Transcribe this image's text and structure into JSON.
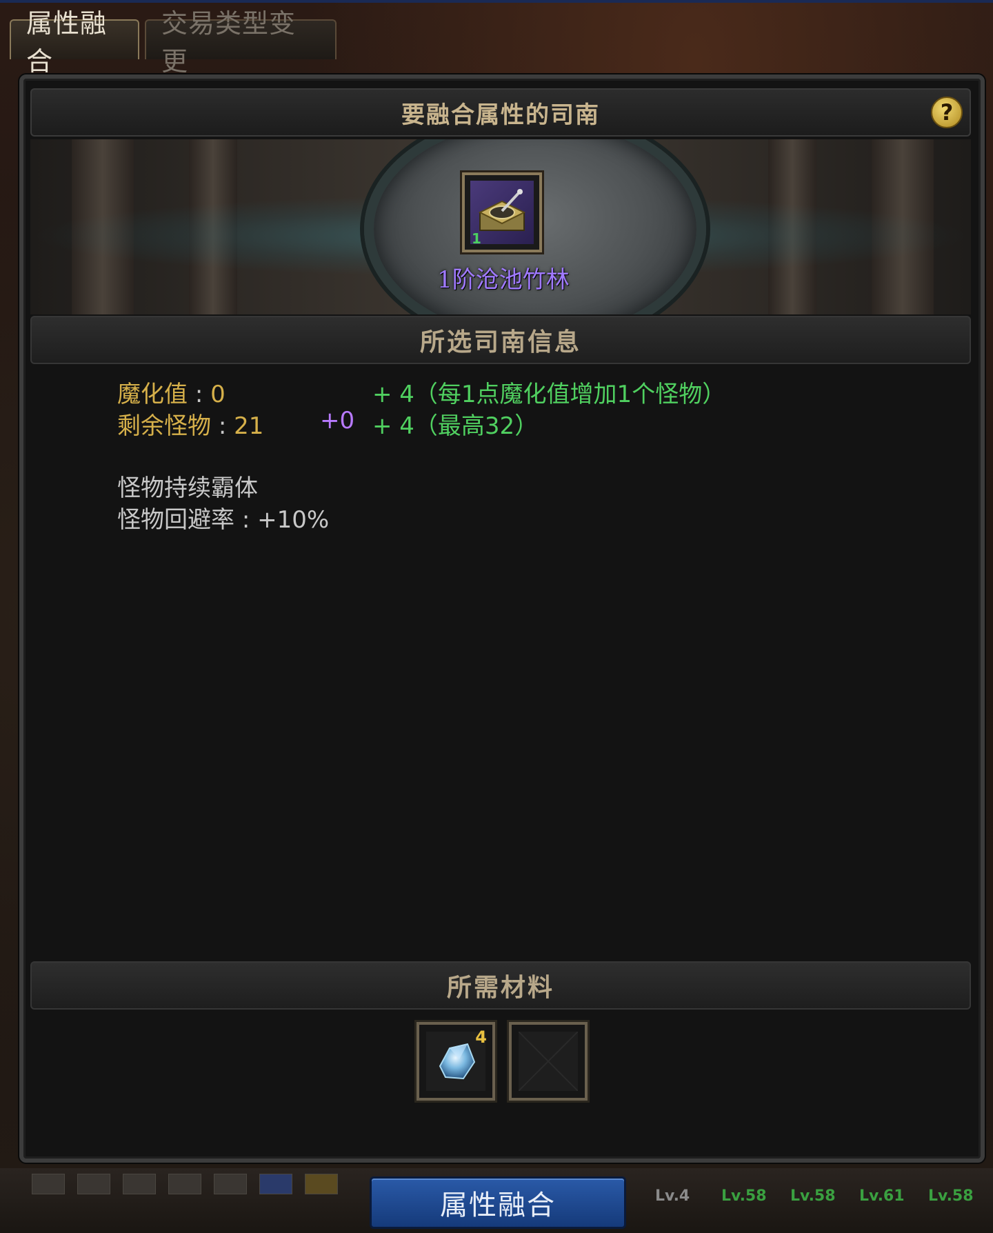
{
  "tabs": [
    {
      "label": "属性融合",
      "active": true
    },
    {
      "label": "交易类型变更",
      "active": false
    }
  ],
  "header": {
    "title": "要融合属性的司南",
    "help_label": "?"
  },
  "selected_item": {
    "name": "1阶沧池竹林",
    "stack": "1",
    "icon": "compass-item-icon"
  },
  "info_section": {
    "title": "所选司南信息"
  },
  "stats": {
    "corruption": {
      "label": "魔化值",
      "sep": ":",
      "value": "0",
      "bonus_text": "+ 4（每1点魔化值增加1个怪物）"
    },
    "remaining": {
      "label": "剩余怪物",
      "sep": ":",
      "value": "21",
      "modifier": "+0",
      "bonus_text": "+ 4（最高32）"
    }
  },
  "effects": {
    "line1": "怪物持续霸体",
    "line2_label": "怪物回避率",
    "line2_sep": ":",
    "line2_value": "+10%"
  },
  "materials_section": {
    "title": "所需材料"
  },
  "materials": [
    {
      "icon": "crystal-icon",
      "count": "4"
    },
    {
      "icon": "empty-slot",
      "count": ""
    }
  ],
  "fuse_button": {
    "label": "属性融合"
  },
  "level_badges": [
    "Lv.4",
    "Lv.58",
    "Lv.58",
    "Lv.61",
    "Lv.58"
  ],
  "colors": {
    "gold": "#d6b04a",
    "green": "#50d060",
    "purple": "#b87aff",
    "item_name": "#a07aff",
    "button_blue": "#2a5aa8"
  }
}
